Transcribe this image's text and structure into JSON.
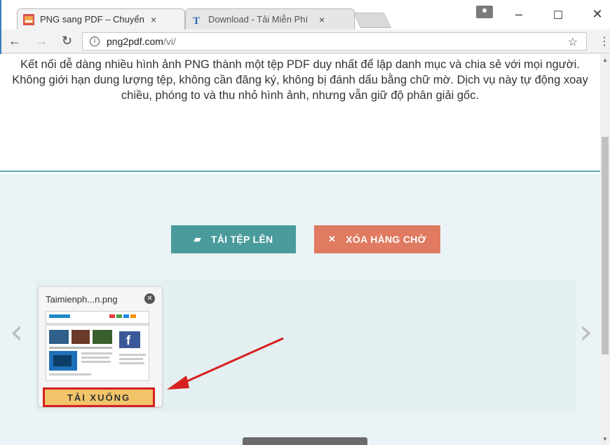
{
  "browser": {
    "tabs": [
      {
        "title": "PNG sang PDF – Chuyển",
        "close": "×"
      },
      {
        "title": "Download - Tải Miễn Phí",
        "close": "×"
      }
    ],
    "window_controls": {
      "minimize": "–",
      "maximize": "☐",
      "close": "✕"
    },
    "url_host": "png2pdf.com",
    "url_path": "/vi/"
  },
  "page": {
    "description": "Kết nối dễ dàng nhiều hình ảnh PNG thành một tệp PDF duy nhất để lập danh mục và chia sẻ với mọi người. Không giới hạn dung lượng tệp, không cần đăng ký, không bị đánh dấu bằng chữ mờ. Dịch vụ này tự động xoay chiều, phóng to và thu nhỏ hình ảnh, nhưng vẫn giữ độ phân giải gốc.",
    "upload_label": "TẢI TỆP LÊN",
    "clear_label": "XÓA HÀNG CHỜ",
    "file": {
      "name": "Taimienph...n.png",
      "download_label": "TẢI XUỐNG"
    }
  },
  "colors": {
    "upload": "#4a9b9c",
    "clear": "#e07a60",
    "download_bg": "#f2c46a",
    "highlight_red": "#d62020"
  }
}
